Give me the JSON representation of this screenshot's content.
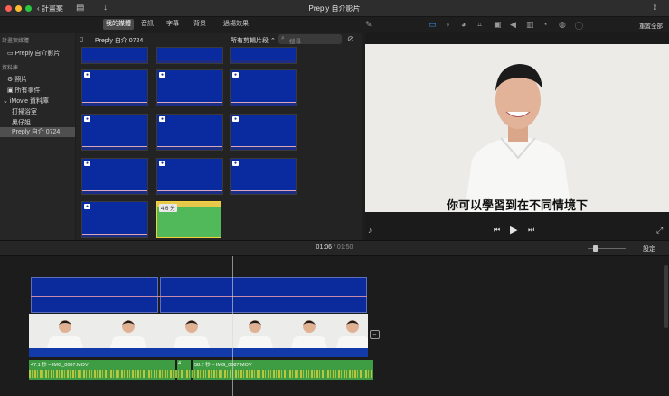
{
  "window": {
    "back_label": "計畫案",
    "title": "Preply 自介影片"
  },
  "media_tabs": [
    "我的媒體",
    "音訊",
    "字幕",
    "背景",
    "過場效果"
  ],
  "sidebar": {
    "section_project": "計畫案媒體",
    "project_item": "Preply 自介影片",
    "section_library": "資料庫",
    "items": [
      {
        "label": "照片",
        "icon": "photos-icon"
      },
      {
        "label": "所有事件",
        "icon": "star-icon"
      }
    ],
    "library_name": "iMovie 資料庫",
    "events": [
      "打掃浴室",
      "黑仔姐",
      "Preply 自介 0724"
    ],
    "selected_event": "Preply 自介 0724"
  },
  "browser": {
    "event_title": "Preply 自介 0724",
    "filter_label": "所有剪輯片段",
    "search_placeholder": "搜尋",
    "selected_clip_duration": "4.6 分"
  },
  "viewer": {
    "reset_all": "重置全部",
    "subtitle": "你可以學習到在不同情境下"
  },
  "timeline": {
    "current_time": "01:06",
    "total_time": "01:50",
    "settings_label": "設定",
    "audio_labels": [
      "47.1 秒 – IMG_0087.MOV",
      "4...",
      "58.7 秒 – IMG_0087.MOV"
    ]
  },
  "colors": {
    "clip_blue": "#0a2aa0",
    "selected_border": "#f2d23a",
    "audio_green": "#3e9d42"
  }
}
